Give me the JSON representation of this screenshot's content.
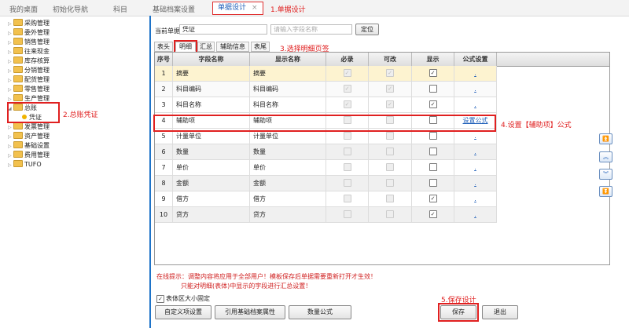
{
  "top_tabs": [
    "我的桌面",
    "初始化导航",
    "科目",
    "基础档案设置"
  ],
  "active_tab": {
    "label": "单据设计",
    "close": "×"
  },
  "annotations": {
    "a1": "1.单据设计",
    "a2": "2.总账凭证",
    "a3": "3.选择明细页签",
    "a4": "4.设置【辅助项】公式",
    "a5": "5.保存设计"
  },
  "tree": {
    "items": [
      "采购管理",
      "委外管理",
      "销售管理",
      "往来现金",
      "库存核算",
      "分销管理",
      "配货管理",
      "零售管理",
      "生产管理"
    ],
    "general_ledger": "总账",
    "voucher": "凭证",
    "items_after": [
      "发票管理",
      "资产管理",
      "基础设置",
      "费用管理",
      "TUFO"
    ]
  },
  "form": {
    "current_doc_label": "当前单据",
    "current_doc_value": "凭证",
    "search_placeholder": "请输入字段名称",
    "locate_button": "定位"
  },
  "subtabs": [
    "表头",
    "明细",
    "汇总",
    "辅助信息",
    "表尾"
  ],
  "table": {
    "headers": [
      "序号",
      "字段名称",
      "显示名称",
      "必录",
      "可改",
      "显示",
      "公式设置"
    ],
    "rows": [
      {
        "no": "1",
        "field": "摘要",
        "display": "摘要",
        "required": true,
        "editable": true,
        "show": true,
        "formula": "."
      },
      {
        "no": "2",
        "field": "科目编码",
        "display": "科目编码",
        "required": true,
        "editable": true,
        "show": false,
        "formula": "."
      },
      {
        "no": "3",
        "field": "科目名称",
        "display": "科目名称",
        "required": true,
        "editable": true,
        "show": true,
        "formula": "."
      },
      {
        "no": "4",
        "field": "辅助项",
        "display": "辅助项",
        "required": false,
        "editable": false,
        "show": false,
        "formula": "设置公式"
      },
      {
        "no": "5",
        "field": "计量单位",
        "display": "计量单位",
        "required": false,
        "editable": false,
        "show": false,
        "formula": "."
      },
      {
        "no": "6",
        "field": "数量",
        "display": "数量",
        "required": false,
        "editable": false,
        "show": false,
        "formula": "."
      },
      {
        "no": "7",
        "field": "单价",
        "display": "单价",
        "required": false,
        "editable": false,
        "show": false,
        "formula": "."
      },
      {
        "no": "8",
        "field": "金额",
        "display": "金额",
        "required": false,
        "editable": false,
        "show": false,
        "formula": "."
      },
      {
        "no": "9",
        "field": "借方",
        "display": "借方",
        "required": false,
        "editable": false,
        "show": true,
        "formula": "."
      },
      {
        "no": "10",
        "field": "贷方",
        "display": "贷方",
        "required": false,
        "editable": false,
        "show": true,
        "formula": "."
      }
    ]
  },
  "side_buttons": [
    "⏫",
    "︽",
    "︾",
    "⏬"
  ],
  "hint": {
    "line1": "在线提示：调整内容将应用于全部用户！模板保存后单据需要重新打开才生效！",
    "line2": "只能对明细(表体)中显示的字段进行汇总设置！"
  },
  "fixed_size_label": "表体区大小固定",
  "buttons": {
    "custom_items": "自定义项设置",
    "ref_archive": "引用基础档案属性",
    "qty_formula": "数量公式",
    "save": "保存",
    "exit": "退出"
  },
  "colors": {
    "accent": "#1e73c8",
    "annotation_red": "#e02020",
    "highlight_row": "#fdf3d0"
  }
}
